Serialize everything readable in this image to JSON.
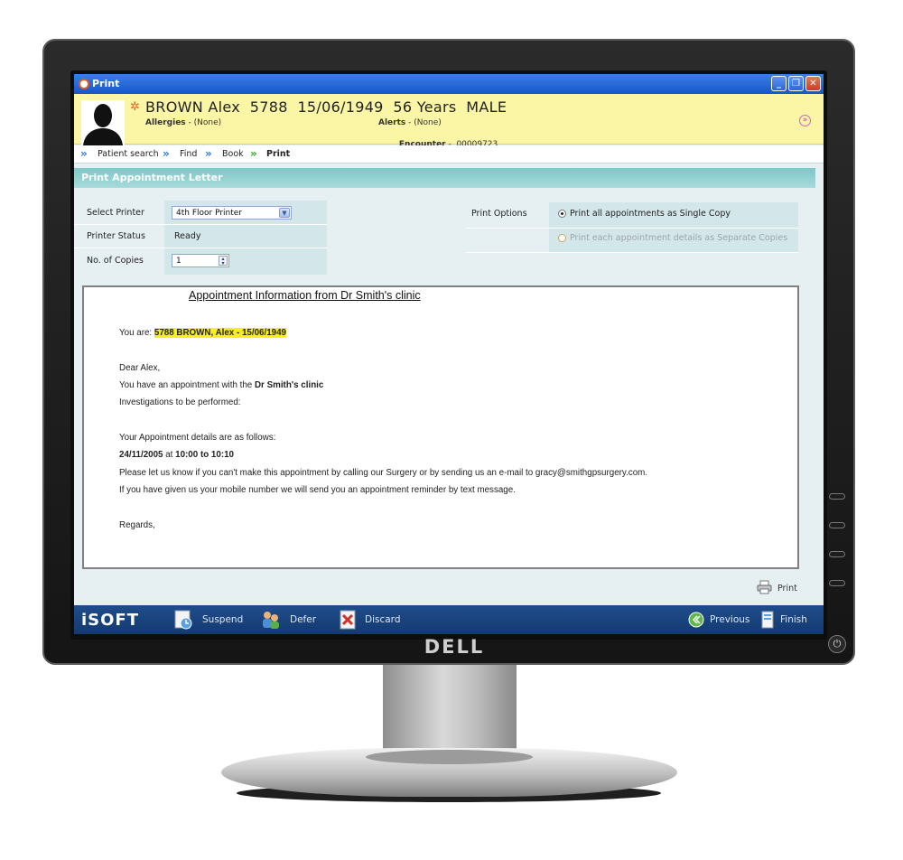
{
  "window": {
    "title": "Print",
    "minimize_glyph": "_",
    "maximize_glyph": "❐",
    "close_glyph": "✕"
  },
  "patient": {
    "name_line": "BROWN Alex  5788  15/06/1949  56 Years  MALE",
    "allergies_label": "Allergies",
    "allergies_value": " - (None)",
    "alerts_label": "Alerts",
    "alerts_value": " - (None)",
    "encounter_label": "Encounter",
    "encounter_value": " -  00009723"
  },
  "breadcrumb": [
    "Patient search",
    "Find",
    "Book",
    "Print"
  ],
  "section_title": "Print Appointment Letter",
  "form": {
    "select_printer_label": "Select Printer",
    "select_printer_value": "4th Floor Printer",
    "printer_status_label": "Printer Status",
    "printer_status_value": "Ready",
    "copies_label": "No. of Copies",
    "copies_value": "1",
    "print_options_label": "Print Options",
    "option_single": "Print all appointments as Single Copy",
    "option_separate": "Print each appointment details as Separate Copies",
    "selected_option": "single"
  },
  "letter": {
    "heading": "Appointment Information from Dr Smith's clinic",
    "you_are_prefix": "You are:",
    "you_are_value": "5788 BROWN, Alex - 15/06/1949",
    "greeting": "Dear Alex,",
    "appt_line_prefix": "You have an appointment with the",
    "appt_line_clinic": "Dr Smith's clinic",
    "investigations": "Investigations to be performed:",
    "details_intro": "Your Appointment details are as follows:",
    "appt_date": "24/11/2005",
    "appt_at": "at",
    "appt_start": "10:00",
    "appt_to": "to",
    "appt_end": "10:10",
    "contact_line": "Please let us know if you can't make this appointment by calling our Surgery or by sending us an e-mail to gracy@smithgpsurgery.com.",
    "mobile_line": "If you have given us your mobile number we will send you an appointment reminder by text message.",
    "closing": "Regards,"
  },
  "print_button": "Print",
  "bottom_bar": {
    "brand": "iSOFT",
    "suspend": "Suspend",
    "defer": "Defer",
    "discard": "Discard",
    "previous": "Previous",
    "finish": "Finish"
  },
  "monitor": {
    "brand": "DELL",
    "power_glyph": "⏻"
  },
  "colors": {
    "titlebar": "#1656c9",
    "banner": "#fbf5a6",
    "section_header": "#7ec7c7",
    "highlight": "#f7f019",
    "bottom_bar": "#1f4d8c"
  }
}
